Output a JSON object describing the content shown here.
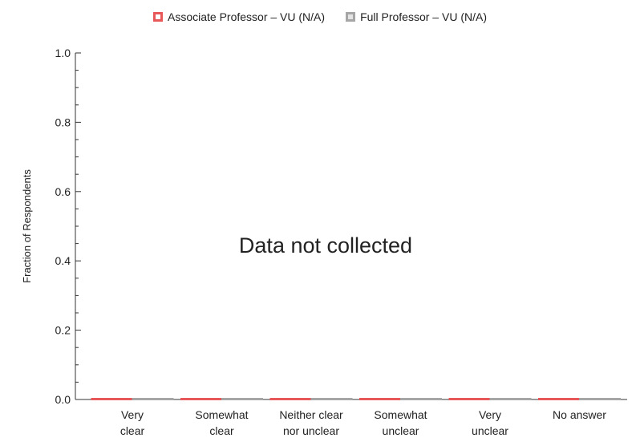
{
  "chart_data": {
    "type": "bar",
    "ylabel": "Fraction of Respondents",
    "ylim": [
      0,
      1.0
    ],
    "yticks": [
      "0.0",
      "0.2",
      "0.4",
      "0.6",
      "0.8",
      "1.0"
    ],
    "categories": [
      [
        "Very",
        "clear"
      ],
      [
        "Somewhat",
        "clear"
      ],
      [
        "Neither clear",
        "nor unclear"
      ],
      [
        "Somewhat",
        "unclear"
      ],
      [
        "Very",
        "unclear"
      ],
      [
        "No answer"
      ]
    ],
    "series": [
      {
        "name": "Associate Professor – VU (N/A)",
        "color": "#e8575a",
        "values": [
          0,
          0,
          0,
          0,
          0,
          0
        ]
      },
      {
        "name": "Full Professor – VU (N/A)",
        "color": "#a6a6a6",
        "values": [
          0,
          0,
          0,
          0,
          0,
          0
        ]
      }
    ],
    "annotation": "Data not collected",
    "grid": false,
    "legend_position": "top-center"
  }
}
